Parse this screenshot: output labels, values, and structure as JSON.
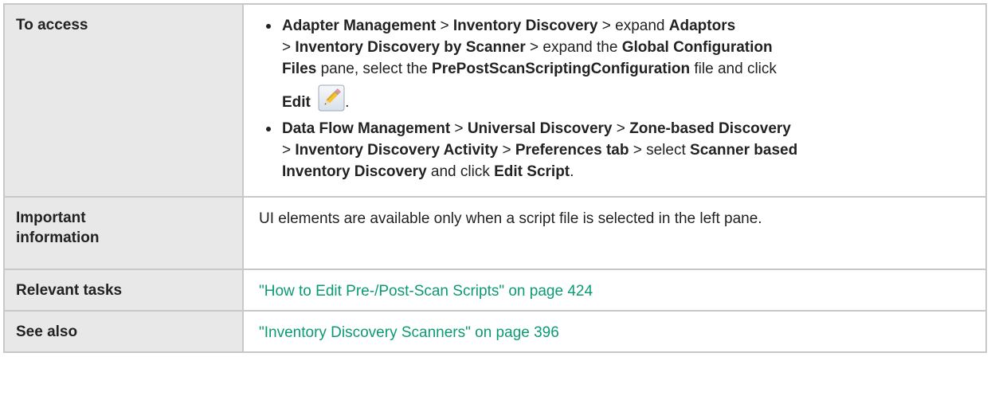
{
  "rows": {
    "access": {
      "label": "To access",
      "bullet1": {
        "t1": "Adapter Management",
        "s1": " > ",
        "t2": "Inventory Discovery",
        "s2": " > expand ",
        "t3": "Adaptors",
        "s3": "> ",
        "t4": "Inventory Discovery by Scanner",
        "s4": " > expand the ",
        "t5": "Global Configuration",
        "t6": "Files",
        "s5": " pane, select the ",
        "t7": "PrePostScanScriptingConfiguration",
        "s6": " file and click",
        "t8": "Edit",
        "s7": "."
      },
      "bullet2": {
        "t1": "Data Flow Management",
        "s1": " > ",
        "t2": "Universal Discovery",
        "s2": " > ",
        "t3": "Zone-based Discovery",
        "s3": "> ",
        "t4": "Inventory Discovery Activity",
        "s4": " > ",
        "t5": "Preferences tab",
        "s5": " > select ",
        "t6": "Scanner based",
        "t7": "Inventory Discovery",
        "s6": " and click ",
        "t8": "Edit Script",
        "s7": "."
      },
      "icon": "pencil-edit-icon"
    },
    "important": {
      "label_line1": "Important",
      "label_line2": "information",
      "text": "UI elements are available only when a script file is selected in the left pane."
    },
    "tasks": {
      "label": "Relevant tasks",
      "link": "\"How to Edit Pre-/Post-Scan Scripts\" on page 424"
    },
    "see_also": {
      "label": "See also",
      "link": "\"Inventory Discovery Scanners\" on page 396"
    }
  },
  "colors": {
    "label_bg": "#e8e8e8",
    "border": "#c8c8c8",
    "link": "#0b9b73"
  }
}
